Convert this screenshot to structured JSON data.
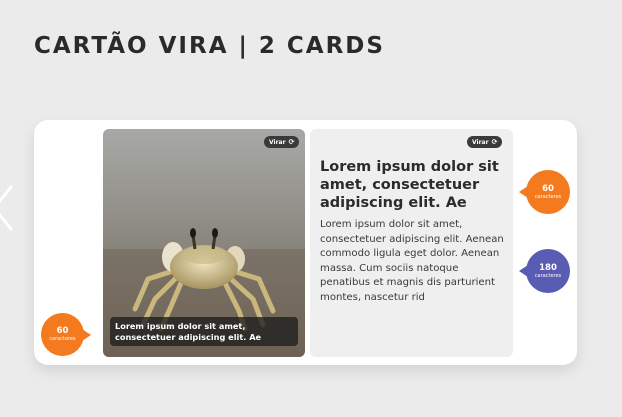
{
  "page": {
    "title": "CARTÃO VIRA | 2 CARDS"
  },
  "cards": [
    {
      "type": "image",
      "flip_label": "Virar",
      "image_subject": "crab on sand",
      "caption": "Lorem ipsum dolor sit amet, consectetuer adipiscing elit. Ae"
    },
    {
      "type": "text",
      "flip_label": "Virar",
      "heading": "Lorem ipsum dolor sit amet, consectetuer adipiscing elit. Ae",
      "body": "Lorem ipsum dolor sit amet, consectetuer adipiscing elit. Aenean commodo ligula eget dolor. Aenean massa. Cum sociis natoque penatibus et magnis dis parturient montes, nascetur rid"
    }
  ],
  "annotations": [
    {
      "value": "60",
      "unit": "caracteres",
      "color": "#f47a1f"
    },
    {
      "value": "60",
      "unit": "caracteres",
      "color": "#f47a1f"
    },
    {
      "value": "180",
      "unit": "caracteres",
      "color": "#5a5bb3"
    }
  ],
  "colors": {
    "background": "#ebebeb",
    "board": "#ffffff",
    "orange": "#f47a1f",
    "purple": "#5a5bb3"
  },
  "icons": {
    "flip": "rotate-icon",
    "prev": "chevron-left-icon"
  }
}
